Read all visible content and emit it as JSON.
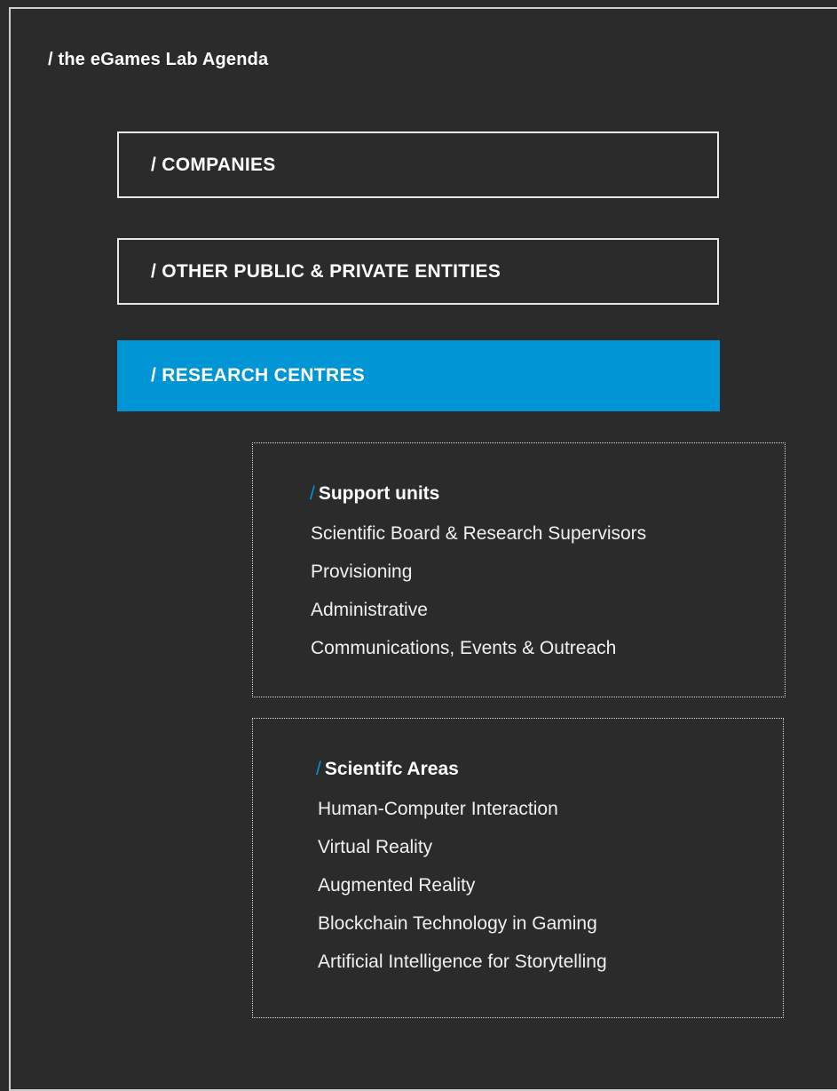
{
  "page": {
    "title": "/ the eGames Lab Agenda"
  },
  "nav": {
    "items": [
      {
        "label": "/ COMPANIES"
      },
      {
        "label": "/ OTHER PUBLIC & PRIVATE ENTITIES"
      },
      {
        "label": "/ RESEARCH CENTRES"
      }
    ],
    "active_index": 2
  },
  "support_units": {
    "slash": "/",
    "heading": "Support units",
    "items": [
      "Scientific Board & Research Supervisors",
      "Provisioning",
      "Administrative",
      "Communications, Events & Outreach"
    ]
  },
  "scientific_areas": {
    "slash": "/",
    "heading": "Scientifc Areas",
    "items": [
      "Human-Computer Interaction",
      "Virtual Reality",
      "Augmented Reality",
      "Blockchain Technology in Gaming",
      "Artificial Intelligence for Storytelling"
    ]
  },
  "colors": {
    "background": "#2b2b2b",
    "accent": "#0096d6",
    "border": "#e8e8e8",
    "text": "#ffffff"
  }
}
